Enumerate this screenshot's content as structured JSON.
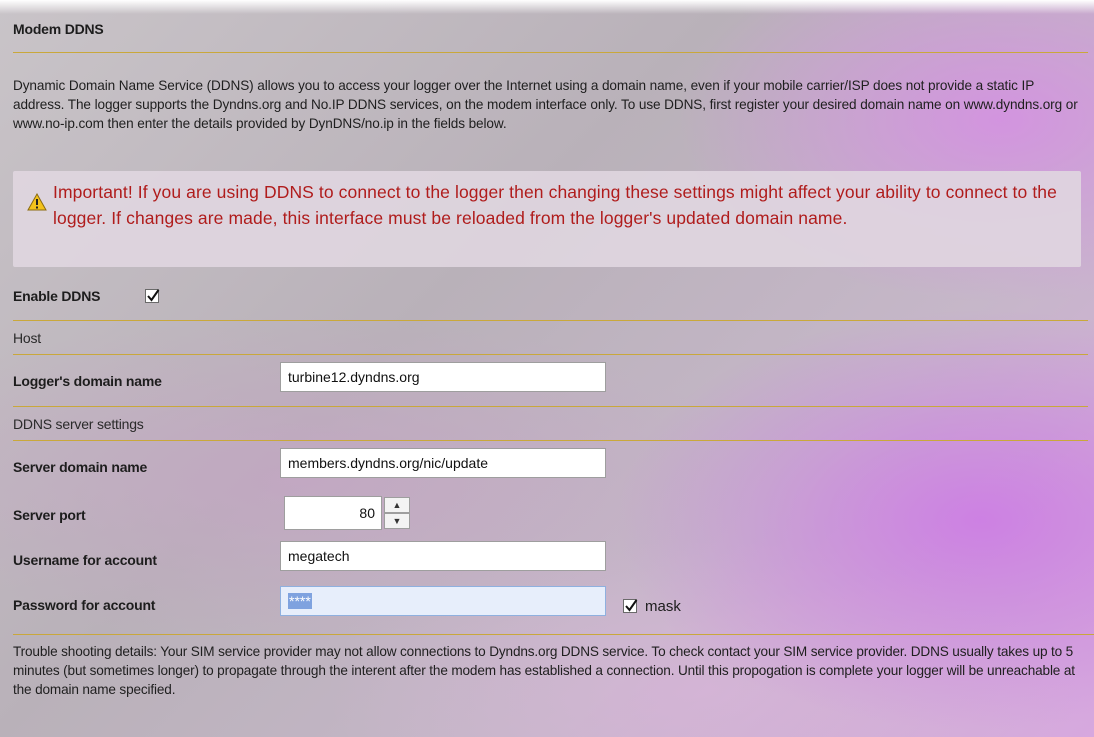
{
  "section": {
    "title": "Modem DDNS",
    "description": "Dynamic Domain Name Service (DDNS) allows you to access your logger over the Internet using a domain name, even if your mobile carrier/ISP does not provide a static IP address. The logger supports the Dyndns.org and No.IP DDNS services, on the modem interface only. To use DDNS, first register your desired domain name on www.dyndns.org or www.no-ip.com then enter the details provided by DynDNS/no.ip in the fields below."
  },
  "important": {
    "icon": "warning-icon",
    "text": "Important!  If you are using DDNS to connect to the logger then changing these settings might affect your ability to connect to the logger.  If changes are made, this interface must be reloaded from the logger's updated domain name."
  },
  "enable": {
    "label": "Enable DDNS",
    "checked": true
  },
  "host": {
    "heading": "Host",
    "domain_label": "Logger's domain name",
    "domain_value": "turbine12.dyndns.org"
  },
  "server": {
    "heading": "DDNS server settings",
    "domain_label": "Server domain name",
    "domain_value": "members.dyndns.org/nic/update",
    "port_label": "Server port",
    "port_value": "80",
    "username_label": "Username for account",
    "username_value": "megatech",
    "password_label": "Password for account",
    "password_value": "****",
    "mask_label": "mask",
    "mask_checked": true
  },
  "trouble": {
    "text": "Trouble shooting details: Your SIM service provider may not allow connections to Dyndns.org DDNS service.  To check contact your SIM service provider. DDNS usually takes up to 5 minutes (but sometimes longer) to propagate through the interent after the modem has established a connection.  Until this propogation is complete your logger will be unreachable at the domain name specified."
  },
  "colors": {
    "divider": "#c9a83b",
    "warning_text": "#b01c1c",
    "accent_purple": "#cd78e6"
  }
}
